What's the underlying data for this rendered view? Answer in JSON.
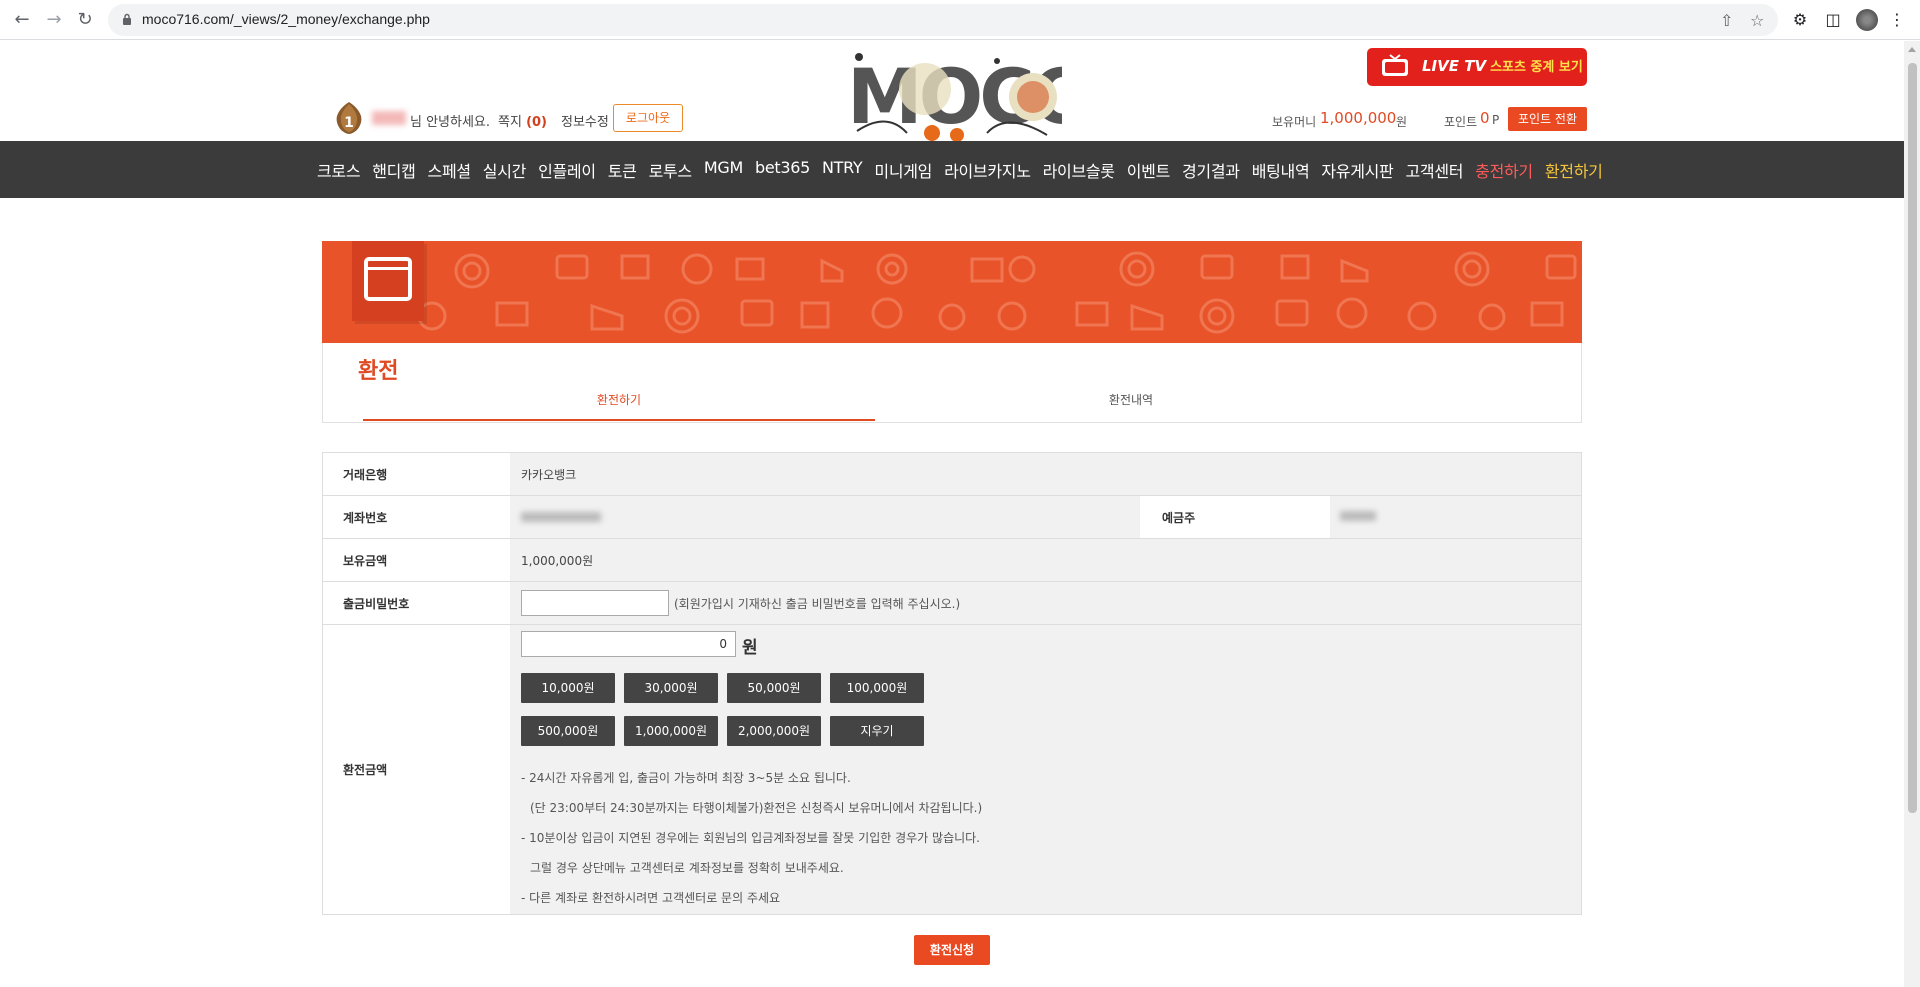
{
  "browser": {
    "url": "moco716.com/_views/2_money/exchange.php"
  },
  "header": {
    "level": "1",
    "greeting": "님 안녕하세요.",
    "memo_label": "쪽지",
    "memo_count": "(0)",
    "profile_label": "정보수정",
    "logout_label": "로그아웃",
    "logo_text": "MOCO",
    "live_tv_label": "LIVE TV",
    "live_tv_sub": "스포츠 중계 보기",
    "money_label": "보유머니",
    "money_value": "1,000,000",
    "money_unit": "원",
    "point_label": "포인트",
    "point_value": "0",
    "point_unit": "P",
    "point_button": "포인트 전환"
  },
  "nav": {
    "items": [
      "크로스",
      "핸디캡",
      "스페셜",
      "실시간",
      "인플레이",
      "토큰",
      "로투스",
      "MGM",
      "bet365",
      "NTRY",
      "미니게임",
      "라이브카지노",
      "라이브슬롯",
      "이벤트",
      "경기결과",
      "배팅내역",
      "자유게시판",
      "고객센터",
      "충전하기",
      "환전하기"
    ]
  },
  "main": {
    "title": "환전",
    "tabs": [
      "환전하기",
      "환전내역"
    ]
  },
  "form": {
    "bank_label": "거래은행",
    "bank_value": "카카오뱅크",
    "account_label": "계좌번호",
    "holder_label": "예금주",
    "balance_label": "보유금액",
    "balance_value": "1,000,000원",
    "password_label": "출금비밀번호",
    "password_hint": "(회원가입시 기재하신 출금 비밀번호를 입력해 주십시오.)",
    "amount_label": "환전금액",
    "amount_value": "0",
    "amount_unit": "원",
    "amount_buttons": [
      "10,000원",
      "30,000원",
      "50,000원",
      "100,000원",
      "500,000원",
      "1,000,000원",
      "2,000,000원",
      "지우기"
    ],
    "notes": [
      "- 24시간 자유롭게 입, 출금이 가능하며 최장 3~5분 소요 됩니다.",
      "(단 23:00부터 24:30분까지는 타행이체불가)환전은 신청즉시 보유머니에서 차감됩니다.)",
      "- 10분이상 입금이 지연된 경우에는 회원님의 입금계좌정보를 잘못 기입한 경우가 많습니다.",
      "그럴 경우 상단메뉴 고객센터로 계좌정보를 정확히 보내주세요.",
      "- 다른 계좌로 환전하시려면 고객센터로 문의 주세요"
    ],
    "submit_label": "환전신청"
  },
  "colors": {
    "accent": "#e9532a",
    "nav_bg": "#3b3b3b",
    "charge_nav": "#ff5a5a",
    "exchange_nav": "#f5c53a"
  }
}
